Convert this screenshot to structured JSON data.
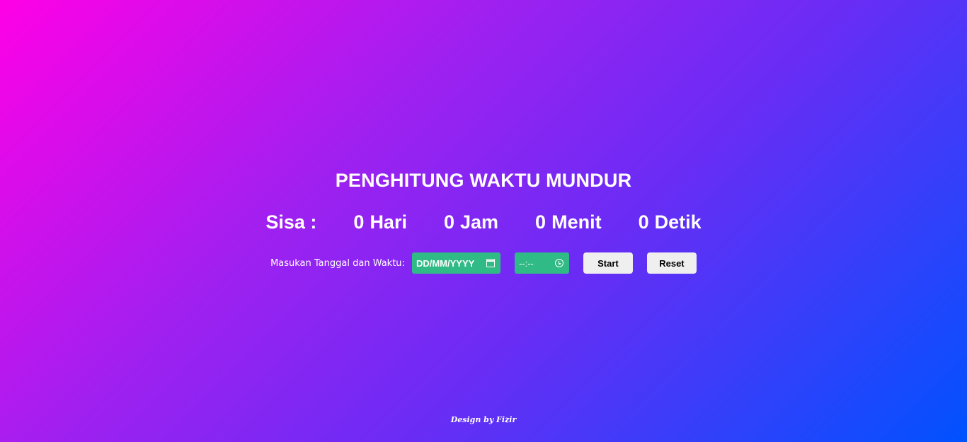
{
  "page": {
    "title": "PENGHITUNG WAKTU MUNDUR"
  },
  "countdown": {
    "prefix": "Sisa :",
    "days_value": "0",
    "days_label": "Hari",
    "hours_value": "0",
    "hours_label": "Jam",
    "minutes_value": "0",
    "minutes_label": "Menit",
    "seconds_value": "0",
    "seconds_label": "Detik"
  },
  "controls": {
    "label": "Masukan Tanggal dan Waktu:",
    "date_placeholder": "DD/MM/YYYY",
    "time_placeholder": "--:--",
    "start_label": "Start",
    "reset_label": "Reset"
  },
  "footer": {
    "credit": "Design by Fizir"
  },
  "colors": {
    "field_bg": "#2fba86",
    "button_bg": "#efefef",
    "gradient_start": "#ff00e6",
    "gradient_end": "#0052ff"
  },
  "icons": {
    "date": "calendar-icon",
    "time": "clock-icon"
  }
}
